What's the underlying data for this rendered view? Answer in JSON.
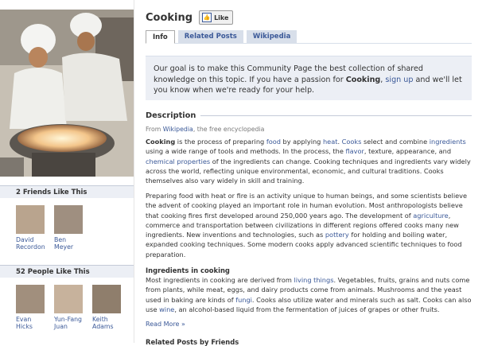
{
  "page": {
    "title": "Cooking",
    "like_label": "Like"
  },
  "tabs": [
    {
      "label": "Info",
      "active": true
    },
    {
      "label": "Related Posts",
      "active": false
    },
    {
      "label": "Wikipedia",
      "active": false
    }
  ],
  "notice": {
    "p1": "Our goal is to make this Community Page the best collection of shared knowledge on this topic. If you have a passion for ",
    "kw": "Cooking",
    "p2": ", ",
    "link": "sign up",
    "p3": " and we'll let you know when we're ready for your help."
  },
  "left": {
    "friends_heading": "2 Friends Like This",
    "friends": [
      {
        "name": "David Recordon"
      },
      {
        "name": "Ben Meyer"
      }
    ],
    "people_heading": "52 People Like This",
    "people": [
      {
        "name": "Evan Hicks"
      },
      {
        "name": "Yun-Fang Juan"
      },
      {
        "name": "Keith Adams"
      }
    ]
  },
  "description": {
    "heading": "Description",
    "from_prefix": "From ",
    "from_link": "Wikipedia",
    "from_suffix": ", the free encyclopedia",
    "para1": [
      {
        "t": "Cooking",
        "s": "b"
      },
      {
        "t": " is the process of preparing "
      },
      {
        "t": "food",
        "s": "a"
      },
      {
        "t": " by applying "
      },
      {
        "t": "heat",
        "s": "a"
      },
      {
        "t": ". "
      },
      {
        "t": "Cooks",
        "s": "a"
      },
      {
        "t": " select and combine "
      },
      {
        "t": "ingredients",
        "s": "a"
      },
      {
        "t": " using a wide range of tools and methods. In the process, the "
      },
      {
        "t": "flavor",
        "s": "a"
      },
      {
        "t": ", texture, appearance, and "
      },
      {
        "t": "chemical properties",
        "s": "a"
      },
      {
        "t": " of the ingredients can change. Cooking techniques and ingredients vary widely across the world, reflecting unique environmental, economic, and cultural traditions. Cooks themselves also vary widely in skill and training."
      }
    ],
    "para2": [
      {
        "t": "Preparing food with heat or fire is an activity unique to human beings, and some scientists believe the advent of cooking played an important role in human evolution. Most anthropologists believe that cooking fires first developed around 250,000 years ago. The development of "
      },
      {
        "t": "agriculture",
        "s": "a"
      },
      {
        "t": ", commerce and transportation between civilizations in different regions offered cooks many new ingredients. New inventions and technologies, such as "
      },
      {
        "t": "pottery",
        "s": "a"
      },
      {
        "t": " for holding and boiling water, expanded cooking techniques. Some modern cooks apply advanced scientific techniques to food preparation."
      }
    ],
    "ingredients_heading": "Ingredients in cooking",
    "para3": [
      {
        "t": "Most ingredients in cooking are derived from "
      },
      {
        "t": "living things",
        "s": "a"
      },
      {
        "t": ". Vegetables, fruits, grains and nuts come from plants, while meat, eggs, and dairy products come from animals. Mushrooms and the yeast used in baking are kinds of "
      },
      {
        "t": "fungi",
        "s": "a"
      },
      {
        "t": ". Cooks also utilize water and minerals such as salt. Cooks can also use "
      },
      {
        "t": "wine",
        "s": "a"
      },
      {
        "t": ", an alcohol-based liquid from the fermentation of juices of grapes or other fruits."
      }
    ],
    "read_more": "Read More »"
  },
  "related_heading": "Related Posts by Friends"
}
